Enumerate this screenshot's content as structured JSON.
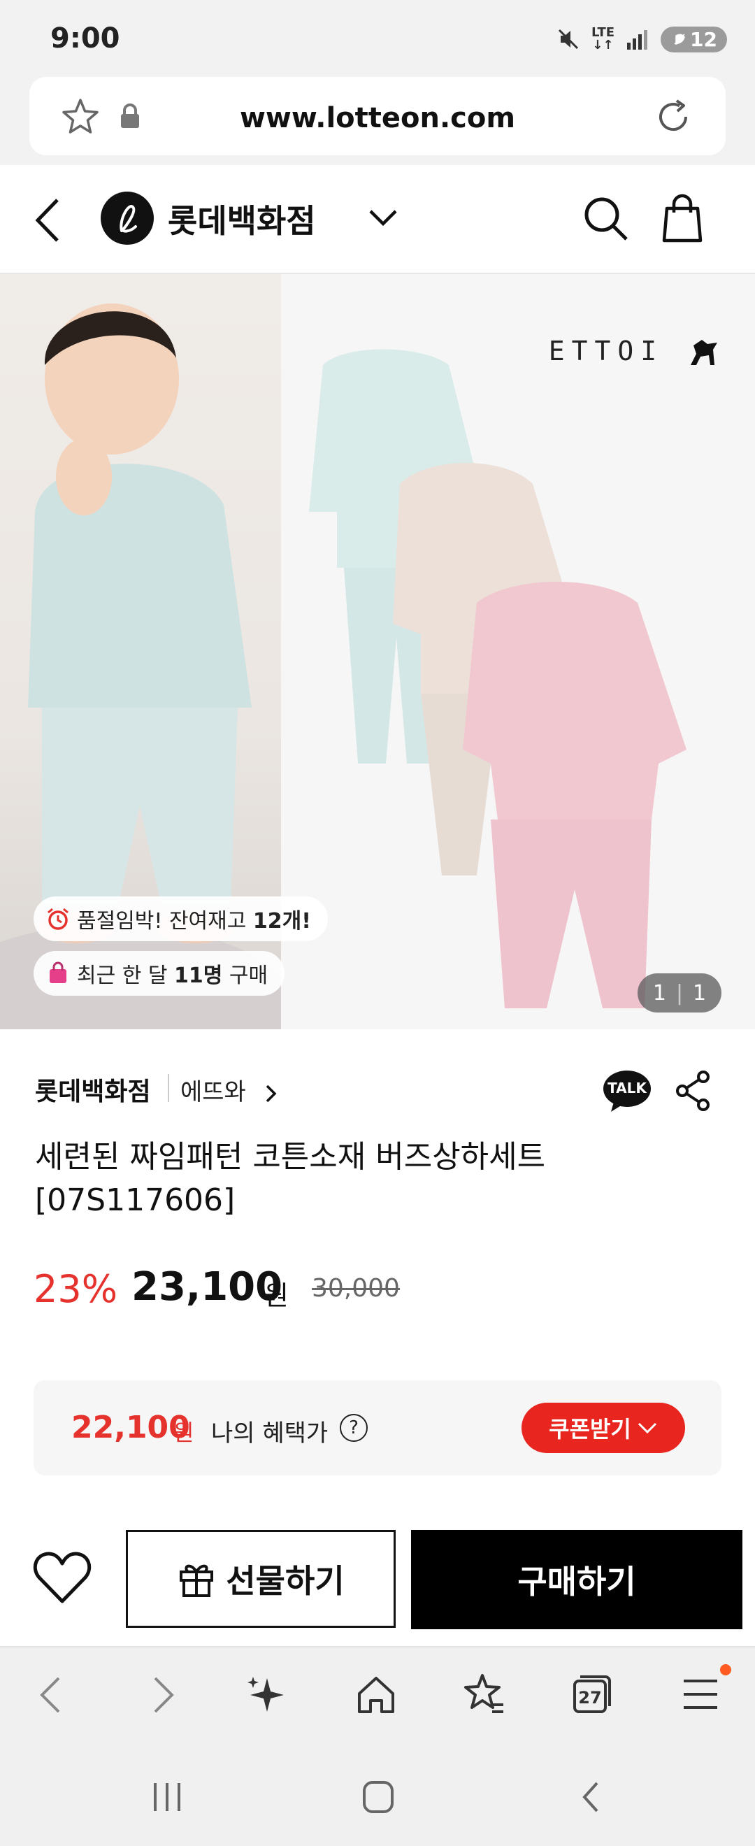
{
  "status_bar": {
    "time": "9:00",
    "network": "LTE",
    "battery": "12"
  },
  "browser": {
    "url": "www.lotteon.com"
  },
  "header": {
    "store_name": "롯데백화점"
  },
  "hero": {
    "brand_logo_text": "ETTOI",
    "badge_stock_prefix": "품절임박! 잔여재고 ",
    "badge_stock_count": "12개!",
    "badge_buyers_prefix": "최근 한 달 ",
    "badge_buyers_count": "11명",
    "badge_buyers_suffix": " 구매",
    "image_index": "1",
    "image_total": "1"
  },
  "product": {
    "seller": "롯데백화점",
    "brand": "에뜨와",
    "talk_label": "TALK",
    "title": "세련된 짜임패턴 코튼소재 버즈상하세트 [07S117606]",
    "discount": "23%",
    "price": "23,100",
    "currency": "원",
    "original_price": "30,000"
  },
  "benefit": {
    "price": "22,100",
    "currency": "원",
    "label": "나의 혜택가",
    "help": "?",
    "coupon_button": "쿠폰받기"
  },
  "actions": {
    "gift_label": "선물하기",
    "buy_label": "구매하기"
  },
  "browser_toolbar": {
    "tabs_count": "27"
  },
  "colors": {
    "accent_red": "#e5322d",
    "coupon_red": "#e8261f",
    "black": "#000000"
  }
}
